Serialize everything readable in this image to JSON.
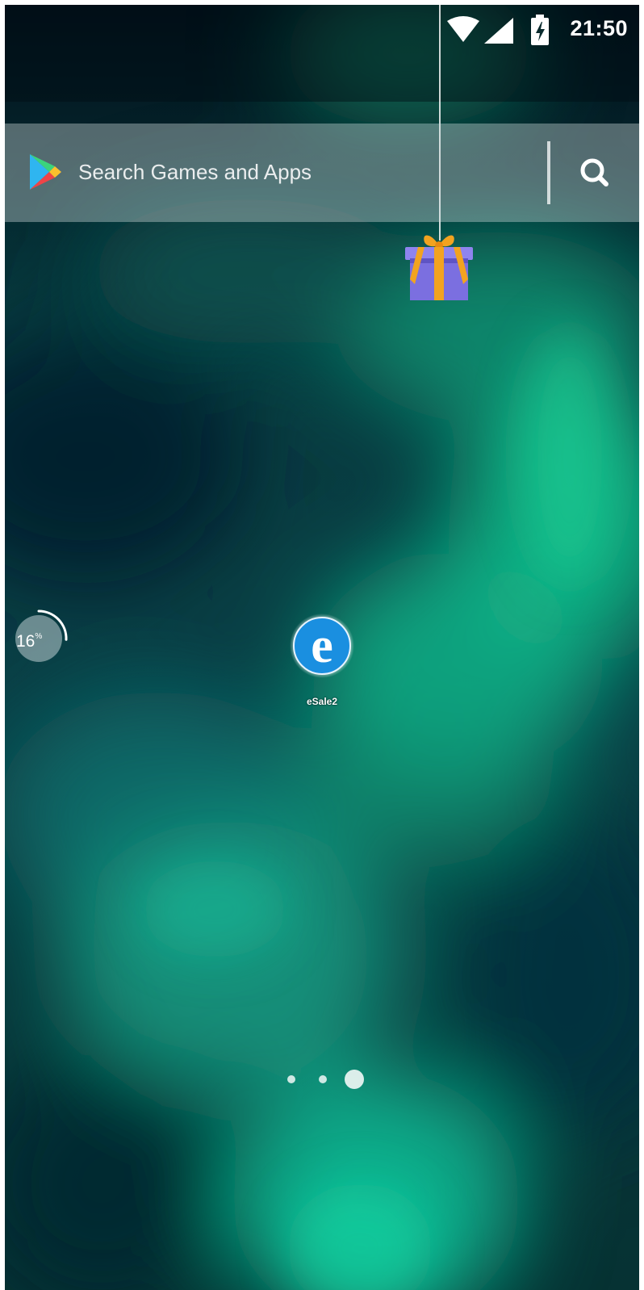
{
  "status_bar": {
    "time": "21:50",
    "icons": [
      "wifi-icon",
      "cell-signal-icon",
      "battery-charging-icon"
    ]
  },
  "search_bar": {
    "placeholder": "Search Games and Apps",
    "logo": "play-store-icon",
    "action_icon": "search-icon"
  },
  "gift": {
    "icon": "gift-icon"
  },
  "memory_widget": {
    "value": "16",
    "unit": "%",
    "level": 0.16
  },
  "apps": [
    {
      "label": "eSale2",
      "icon": "esale-app-icon"
    }
  ],
  "page_indicator": {
    "pages": 3,
    "current": 3
  },
  "colors": {
    "icon_blue": "#1a8fe0",
    "gift_purple": "#7b6fe0",
    "gift_orange": "#f2a320",
    "aurora_green": "#12c795"
  }
}
